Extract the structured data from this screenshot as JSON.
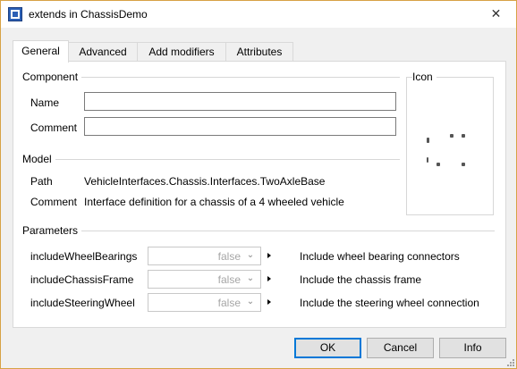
{
  "window": {
    "title": "extends in ChassisDemo",
    "close_glyph": "✕"
  },
  "tabs": [
    {
      "label": "General",
      "active": true
    },
    {
      "label": "Advanced",
      "active": false
    },
    {
      "label": "Add modifiers",
      "active": false
    },
    {
      "label": "Attributes",
      "active": false
    }
  ],
  "component": {
    "group_label": "Component",
    "name_label": "Name",
    "name_value": "",
    "comment_label": "Comment",
    "comment_value": ""
  },
  "icon_group_label": "Icon",
  "model": {
    "group_label": "Model",
    "path_label": "Path",
    "path_value": "VehicleInterfaces.Chassis.Interfaces.TwoAxleBase",
    "comment_label": "Comment",
    "comment_value": "Interface definition for a chassis of a 4 wheeled vehicle"
  },
  "parameters": {
    "group_label": "Parameters",
    "rows": [
      {
        "name": "includeWheelBearings",
        "value": "false",
        "description": "Include wheel bearing connectors"
      },
      {
        "name": "includeChassisFrame",
        "value": "false",
        "description": "Include the chassis frame"
      },
      {
        "name": "includeSteeringWheel",
        "value": "false",
        "description": "Include the steering wheel connection"
      }
    ]
  },
  "buttons": {
    "ok": "OK",
    "cancel": "Cancel",
    "info": "Info"
  },
  "colors": {
    "window_border": "#d7a245",
    "default_button_border": "#0078d7"
  }
}
